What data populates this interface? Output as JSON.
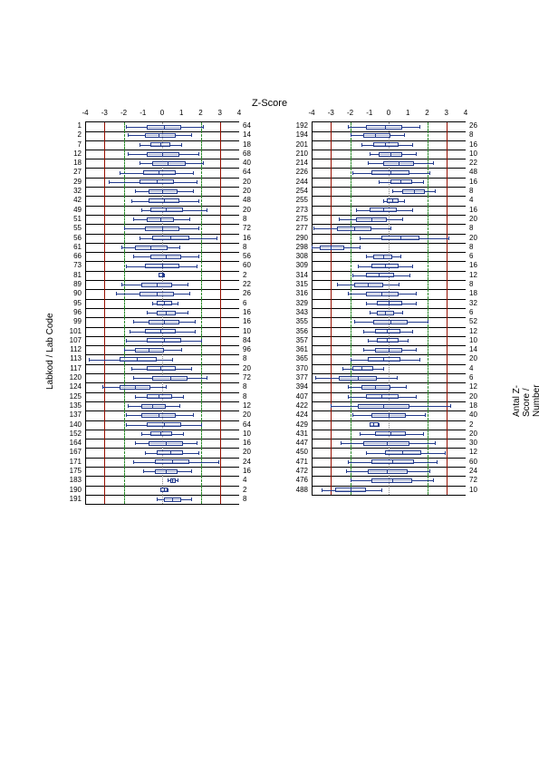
{
  "chart_data": {
    "type": "boxplot",
    "title": "Z-Score",
    "ylabel_left": "Labkod / Lab Code",
    "ylabel_right": "Antal Z-Score / Number of Z-Score",
    "xlim": [
      -4,
      4
    ],
    "xticks": [
      -4,
      -3,
      -2,
      -1,
      0,
      1,
      2,
      3,
      4
    ],
    "ref_lines": {
      "solid": [
        -4,
        4
      ],
      "red": [
        -3,
        3
      ],
      "dash": [
        -2,
        2
      ],
      "dot": [
        0
      ]
    },
    "panels": [
      {
        "id": "left",
        "rows": [
          {
            "lab": "1",
            "n": 64,
            "wl": -1.9,
            "q1": -0.8,
            "med": 0.1,
            "q3": 1.0,
            "wh": 2.1
          },
          {
            "lab": "2",
            "n": 14,
            "wl": -1.8,
            "q1": -0.9,
            "med": -0.2,
            "q3": 0.7,
            "wh": 1.5
          },
          {
            "lab": "7",
            "n": 18,
            "wl": -1.2,
            "q1": -0.6,
            "med": -0.1,
            "q3": 0.4,
            "wh": 1.0
          },
          {
            "lab": "12",
            "n": 68,
            "wl": -1.8,
            "q1": -0.8,
            "med": 0.0,
            "q3": 0.9,
            "wh": 1.9
          },
          {
            "lab": "18",
            "n": 40,
            "wl": -1.2,
            "q1": -0.5,
            "med": 0.3,
            "q3": 1.2,
            "wh": 2.1
          },
          {
            "lab": "27",
            "n": 64,
            "wl": -2.2,
            "q1": -1.0,
            "med": -0.2,
            "q3": 0.7,
            "wh": 1.6
          },
          {
            "lab": "29",
            "n": 20,
            "wl": -2.8,
            "q1": -1.2,
            "med": -0.3,
            "q3": 0.6,
            "wh": 1.8
          },
          {
            "lab": "32",
            "n": 20,
            "wl": -1.4,
            "q1": -0.7,
            "med": 0.0,
            "q3": 0.8,
            "wh": 1.6
          },
          {
            "lab": "42",
            "n": 48,
            "wl": -1.6,
            "q1": -0.7,
            "med": 0.1,
            "q3": 0.9,
            "wh": 1.9
          },
          {
            "lab": "49",
            "n": 20,
            "wl": -1.1,
            "q1": -0.6,
            "med": 0.2,
            "q3": 1.1,
            "wh": 2.3
          },
          {
            "lab": "51",
            "n": 8,
            "wl": -1.5,
            "q1": -0.8,
            "med": -0.1,
            "q3": 0.6,
            "wh": 1.4
          },
          {
            "lab": "55",
            "n": 72,
            "wl": -2.0,
            "q1": -0.9,
            "med": 0.0,
            "q3": 0.9,
            "wh": 1.9
          },
          {
            "lab": "56",
            "n": 16,
            "wl": -1.2,
            "q1": -0.5,
            "med": 0.4,
            "q3": 1.4,
            "wh": 2.8
          },
          {
            "lab": "61",
            "n": 8,
            "wl": -2.1,
            "q1": -1.4,
            "med": -0.6,
            "q3": 0.3,
            "wh": 0.9
          },
          {
            "lab": "66",
            "n": 56,
            "wl": -1.5,
            "q1": -0.6,
            "med": 0.2,
            "q3": 1.0,
            "wh": 1.9
          },
          {
            "lab": "73",
            "n": 60,
            "wl": -1.9,
            "q1": -0.9,
            "med": 0.0,
            "q3": 0.9,
            "wh": 1.8
          },
          {
            "lab": "81",
            "n": 2,
            "wl": -0.2,
            "q1": -0.2,
            "med": 0.0,
            "q3": 0.1,
            "wh": 0.1
          },
          {
            "lab": "89",
            "n": 22,
            "wl": -2.1,
            "q1": -1.1,
            "med": -0.3,
            "q3": 0.5,
            "wh": 1.3
          },
          {
            "lab": "90",
            "n": 26,
            "wl": -2.4,
            "q1": -1.2,
            "med": -0.3,
            "q3": 0.6,
            "wh": 1.4
          },
          {
            "lab": "95",
            "n": 6,
            "wl": -0.5,
            "q1": -0.3,
            "med": 0.1,
            "q3": 0.5,
            "wh": 0.8
          },
          {
            "lab": "96",
            "n": 16,
            "wl": -0.8,
            "q1": -0.3,
            "med": 0.2,
            "q3": 0.7,
            "wh": 1.3
          },
          {
            "lab": "99",
            "n": 16,
            "wl": -1.5,
            "q1": -0.7,
            "med": 0.1,
            "q3": 0.9,
            "wh": 1.7
          },
          {
            "lab": "101",
            "n": 10,
            "wl": -1.7,
            "q1": -0.9,
            "med": -0.1,
            "q3": 0.7,
            "wh": 1.7
          },
          {
            "lab": "107",
            "n": 84,
            "wl": -1.9,
            "q1": -0.8,
            "med": 0.1,
            "q3": 1.0,
            "wh": 2.0
          },
          {
            "lab": "112",
            "n": 96,
            "wl": -2.0,
            "q1": -1.4,
            "med": -0.7,
            "q3": 0.1,
            "wh": 1.0
          },
          {
            "lab": "113",
            "n": 8,
            "wl": -3.8,
            "q1": -2.2,
            "med": -1.3,
            "q3": -0.3,
            "wh": 0.5
          },
          {
            "lab": "117",
            "n": 20,
            "wl": -1.6,
            "q1": -0.8,
            "med": -0.1,
            "q3": 0.7,
            "wh": 1.5
          },
          {
            "lab": "120",
            "n": 72,
            "wl": -1.5,
            "q1": -0.5,
            "med": 0.4,
            "q3": 1.3,
            "wh": 2.3
          },
          {
            "lab": "124",
            "n": 8,
            "wl": -3.1,
            "q1": -2.2,
            "med": -1.4,
            "q3": -0.6,
            "wh": 0.2
          },
          {
            "lab": "125",
            "n": 8,
            "wl": -1.4,
            "q1": -0.8,
            "med": -0.2,
            "q3": 0.5,
            "wh": 1.1
          },
          {
            "lab": "135",
            "n": 12,
            "wl": -1.8,
            "q1": -1.1,
            "med": -0.5,
            "q3": 0.2,
            "wh": 0.9
          },
          {
            "lab": "137",
            "n": 20,
            "wl": -1.9,
            "q1": -1.1,
            "med": -0.2,
            "q3": 0.7,
            "wh": 1.6
          },
          {
            "lab": "140",
            "n": 64,
            "wl": -1.9,
            "q1": -0.8,
            "med": 0.1,
            "q3": 1.0,
            "wh": 2.0
          },
          {
            "lab": "152",
            "n": 10,
            "wl": -1.1,
            "q1": -0.6,
            "med": -0.1,
            "q3": 0.5,
            "wh": 1.1
          },
          {
            "lab": "164",
            "n": 16,
            "wl": -1.4,
            "q1": -0.7,
            "med": 0.2,
            "q3": 1.1,
            "wh": 1.8
          },
          {
            "lab": "167",
            "n": 20,
            "wl": -0.9,
            "q1": -0.3,
            "med": 0.4,
            "q3": 1.1,
            "wh": 1.9
          },
          {
            "lab": "171",
            "n": 24,
            "wl": -1.5,
            "q1": -0.4,
            "med": 0.5,
            "q3": 1.4,
            "wh": 2.9
          },
          {
            "lab": "175",
            "n": 16,
            "wl": -1.0,
            "q1": -0.4,
            "med": 0.2,
            "q3": 0.8,
            "wh": 1.5
          },
          {
            "lab": "183",
            "n": 4,
            "wl": 0.3,
            "q1": 0.4,
            "med": 0.5,
            "q3": 0.7,
            "wh": 0.8
          },
          {
            "lab": "190",
            "n": 2,
            "wl": -0.1,
            "q1": -0.1,
            "med": 0.1,
            "q3": 0.3,
            "wh": 0.3
          },
          {
            "lab": "191",
            "n": 8,
            "wl": -0.3,
            "q1": 0.1,
            "med": 0.5,
            "q3": 1.0,
            "wh": 1.5
          }
        ]
      },
      {
        "id": "right",
        "rows": [
          {
            "lab": "192",
            "n": 26,
            "wl": -2.1,
            "q1": -1.2,
            "med": -0.2,
            "q3": 0.7,
            "wh": 1.6
          },
          {
            "lab": "194",
            "n": 8,
            "wl": -2.0,
            "q1": -1.3,
            "med": -0.7,
            "q3": 0.1,
            "wh": 0.8
          },
          {
            "lab": "201",
            "n": 16,
            "wl": -1.4,
            "q1": -0.8,
            "med": -0.2,
            "q3": 0.5,
            "wh": 1.2
          },
          {
            "lab": "210",
            "n": 10,
            "wl": -1.0,
            "q1": -0.5,
            "med": 0.1,
            "q3": 0.7,
            "wh": 1.4
          },
          {
            "lab": "214",
            "n": 22,
            "wl": -1.1,
            "q1": -0.3,
            "med": 0.5,
            "q3": 1.3,
            "wh": 2.3
          },
          {
            "lab": "226",
            "n": 48,
            "wl": -1.9,
            "q1": -0.9,
            "med": 0.1,
            "q3": 1.1,
            "wh": 2.1
          },
          {
            "lab": "244",
            "n": 16,
            "wl": -0.5,
            "q1": 0.1,
            "med": 0.6,
            "q3": 1.2,
            "wh": 1.8
          },
          {
            "lab": "254",
            "n": 8,
            "wl": 0.2,
            "q1": 0.7,
            "med": 1.3,
            "q3": 1.9,
            "wh": 2.4
          },
          {
            "lab": "255",
            "n": 4,
            "wl": -0.3,
            "q1": -0.1,
            "med": 0.2,
            "q3": 0.5,
            "wh": 0.8
          },
          {
            "lab": "273",
            "n": 16,
            "wl": -1.7,
            "q1": -1.0,
            "med": -0.3,
            "q3": 0.4,
            "wh": 1.2
          },
          {
            "lab": "275",
            "n": 20,
            "wl": -2.6,
            "q1": -1.7,
            "med": -0.9,
            "q3": -0.1,
            "wh": 0.7
          },
          {
            "lab": "277",
            "n": 8,
            "wl": -3.9,
            "q1": -2.7,
            "med": -1.8,
            "q3": -0.9,
            "wh": 0.1
          },
          {
            "lab": "290",
            "n": 20,
            "wl": -1.5,
            "q1": -0.4,
            "med": 0.6,
            "q3": 1.6,
            "wh": 3.1
          },
          {
            "lab": "298",
            "n": 8,
            "wl": -4.0,
            "q1": -3.6,
            "med": -3.0,
            "q3": -2.3,
            "wh": -1.5
          },
          {
            "lab": "308",
            "n": 6,
            "wl": -1.2,
            "q1": -0.8,
            "med": -0.3,
            "q3": 0.2,
            "wh": 0.6
          },
          {
            "lab": "309",
            "n": 16,
            "wl": -1.6,
            "q1": -0.9,
            "med": -0.2,
            "q3": 0.5,
            "wh": 1.2
          },
          {
            "lab": "314",
            "n": 12,
            "wl": -1.9,
            "q1": -1.2,
            "med": -0.5,
            "q3": 0.3,
            "wh": 1.1
          },
          {
            "lab": "315",
            "n": 8,
            "wl": -2.7,
            "q1": -1.8,
            "med": -1.1,
            "q3": -0.3,
            "wh": 0.5
          },
          {
            "lab": "316",
            "n": 18,
            "wl": -2.1,
            "q1": -1.2,
            "med": -0.4,
            "q3": 0.5,
            "wh": 1.4
          },
          {
            "lab": "329",
            "n": 32,
            "wl": -1.2,
            "q1": -0.6,
            "med": 0.0,
            "q3": 0.7,
            "wh": 1.4
          },
          {
            "lab": "343",
            "n": 6,
            "wl": -1.0,
            "q1": -0.6,
            "med": -0.2,
            "q3": 0.3,
            "wh": 0.7
          },
          {
            "lab": "355",
            "n": 52,
            "wl": -1.8,
            "q1": -0.8,
            "med": 0.1,
            "q3": 1.0,
            "wh": 2.0
          },
          {
            "lab": "356",
            "n": 12,
            "wl": -1.3,
            "q1": -0.7,
            "med": -0.1,
            "q3": 0.6,
            "wh": 1.2
          },
          {
            "lab": "357",
            "n": 10,
            "wl": -1.1,
            "q1": -0.6,
            "med": -0.1,
            "q3": 0.5,
            "wh": 1.0
          },
          {
            "lab": "361",
            "n": 14,
            "wl": -1.3,
            "q1": -0.7,
            "med": 0.0,
            "q3": 0.7,
            "wh": 1.4
          },
          {
            "lab": "365",
            "n": 20,
            "wl": -2.0,
            "q1": -1.1,
            "med": -0.3,
            "q3": 0.6,
            "wh": 1.6
          },
          {
            "lab": "370",
            "n": 4,
            "wl": -2.4,
            "q1": -1.9,
            "med": -1.4,
            "q3": -0.8,
            "wh": -0.3
          },
          {
            "lab": "377",
            "n": 6,
            "wl": -3.8,
            "q1": -2.6,
            "med": -1.6,
            "q3": -0.6,
            "wh": 0.4
          },
          {
            "lab": "394",
            "n": 12,
            "wl": -2.1,
            "q1": -1.4,
            "med": -0.7,
            "q3": 0.1,
            "wh": 0.9
          },
          {
            "lab": "407",
            "n": 20,
            "wl": -2.1,
            "q1": -1.2,
            "med": -0.4,
            "q3": 0.5,
            "wh": 1.4
          },
          {
            "lab": "422",
            "n": 18,
            "wl": -3.0,
            "q1": -1.6,
            "med": -0.3,
            "q3": 1.1,
            "wh": 3.2
          },
          {
            "lab": "424",
            "n": 40,
            "wl": -1.9,
            "q1": -0.9,
            "med": 0.0,
            "q3": 0.9,
            "wh": 1.9
          },
          {
            "lab": "429",
            "n": 2,
            "wl": -1.0,
            "q1": -1.0,
            "med": -0.8,
            "q3": -0.5,
            "wh": -0.5
          },
          {
            "lab": "431",
            "n": 20,
            "wl": -1.5,
            "q1": -0.7,
            "med": 0.1,
            "q3": 0.9,
            "wh": 1.8
          },
          {
            "lab": "447",
            "n": 30,
            "wl": -2.5,
            "q1": -1.3,
            "med": -0.1,
            "q3": 1.1,
            "wh": 2.4
          },
          {
            "lab": "450",
            "n": 12,
            "wl": -1.2,
            "q1": -0.2,
            "med": 0.7,
            "q3": 1.7,
            "wh": 2.9
          },
          {
            "lab": "471",
            "n": 60,
            "wl": -2.1,
            "q1": -0.9,
            "med": 0.2,
            "q3": 1.3,
            "wh": 2.5
          },
          {
            "lab": "472",
            "n": 24,
            "wl": -2.2,
            "q1": -1.1,
            "med": -0.1,
            "q3": 1.0,
            "wh": 2.1
          },
          {
            "lab": "476",
            "n": 72,
            "wl": -2.0,
            "q1": -0.9,
            "med": 0.2,
            "q3": 1.2,
            "wh": 2.3
          },
          {
            "lab": "488",
            "n": 10,
            "wl": -3.5,
            "q1": -2.8,
            "med": -2.0,
            "q3": -1.2,
            "wh": -0.4
          }
        ]
      }
    ]
  }
}
